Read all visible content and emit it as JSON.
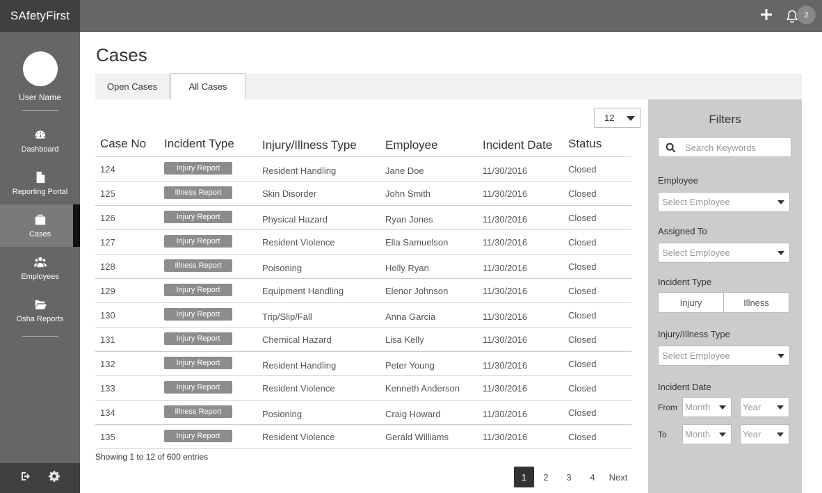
{
  "brand": "SAfetyFirst",
  "user": {
    "name": "User Name"
  },
  "nav": [
    {
      "label": "Dashboard",
      "icon": "dashboard-icon"
    },
    {
      "label": "Reporting Portal",
      "icon": "document-icon"
    },
    {
      "label": "Cases",
      "icon": "briefcase-icon",
      "active": true
    },
    {
      "label": "Employees",
      "icon": "users-icon"
    },
    {
      "label": "Osha Reports",
      "icon": "folder-icon"
    }
  ],
  "topbar": {
    "notification_count": "2"
  },
  "page": {
    "title": "Cases"
  },
  "tabs": [
    {
      "label": "Open Cases"
    },
    {
      "label": "All Cases",
      "active": true
    }
  ],
  "page_size": "12",
  "table": {
    "headers": [
      "Case No",
      "Incident Type",
      "Injury/Illness Type",
      "Employee",
      "Incident Date",
      "Status"
    ],
    "rows": [
      {
        "case": "124",
        "type": "Injury Report",
        "injury": "Resident Handling",
        "employee": "Jane Doe",
        "date": "11/30/2016",
        "status": "Closed"
      },
      {
        "case": "125",
        "type": "Illness Report",
        "injury": "Skin Disorder",
        "employee": "John Smith",
        "date": "11/30/2016",
        "status": "Closed"
      },
      {
        "case": "126",
        "type": "Injury Report",
        "injury": "Physical Hazard",
        "employee": "Ryan Jones",
        "date": "11/30/2016",
        "status": "Closed"
      },
      {
        "case": "127",
        "type": "Injury Report",
        "injury": "Resident Violence",
        "employee": "Ella Samuelson",
        "date": "11/30/2016",
        "status": "Closed"
      },
      {
        "case": "128",
        "type": "Illness Report",
        "injury": "Poisoning",
        "employee": "Holly Ryan",
        "date": "11/30/2016",
        "status": "Closed"
      },
      {
        "case": "129",
        "type": "Injury Report",
        "injury": "Equipment Handling",
        "employee": "Elenor Johnson",
        "date": "11/30/2016",
        "status": "Closed"
      },
      {
        "case": "130",
        "type": "Injury Report",
        "injury": "Trip/Slip/Fall",
        "employee": "Anna Garcia",
        "date": "11/30/2016",
        "status": "Closed"
      },
      {
        "case": "131",
        "type": "Injury Report",
        "injury": "Chemical Hazard",
        "employee": "Lisa Kelly",
        "date": "11/30/2016",
        "status": "Closed"
      },
      {
        "case": "132",
        "type": "Injury Report",
        "injury": "Resident Handling",
        "employee": "Peter Young",
        "date": "11/30/2016",
        "status": "Closed"
      },
      {
        "case": "133",
        "type": "Injury Report",
        "injury": "Resident Violence",
        "employee": "Kenneth Anderson",
        "date": "11/30/2016",
        "status": "Closed"
      },
      {
        "case": "134",
        "type": "Illness Report",
        "injury": "Posioning",
        "employee": "Craig Howard",
        "date": "11/30/2016",
        "status": "Closed"
      },
      {
        "case": "135",
        "type": "Injury Report",
        "injury": "Resident Violence",
        "employee": "Gerald Williams",
        "date": "11/30/2016",
        "status": "Closed"
      }
    ]
  },
  "showing": "Showing 1 to 12 of 600 entries",
  "pagination": {
    "pages": [
      "1",
      "2",
      "3",
      "4"
    ],
    "next": "Next",
    "current": "1"
  },
  "filters": {
    "title": "Filters",
    "search_placeholder": "Search Keywords",
    "employee_label": "Employee",
    "employee_value": "Select Employee",
    "assigned_label": "Assigned To",
    "assigned_value": "Select Employee",
    "incident_type_label": "Incident Type",
    "incident_type_options": [
      "Injury",
      "Illness"
    ],
    "injury_type_label": "Injury/Illness Type",
    "injury_type_value": "Select Employee",
    "incident_date_label": "Incident Date",
    "from_label": "From",
    "to_label": "To",
    "month_placeholder": "Month",
    "year_placeholder": "Year"
  }
}
